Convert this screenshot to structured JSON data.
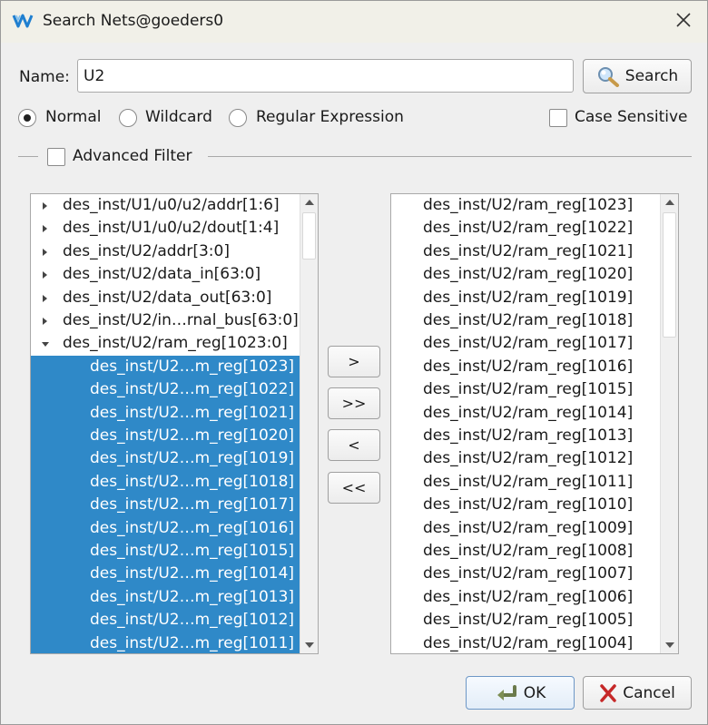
{
  "window": {
    "title": "Search Nets@goeders0"
  },
  "search": {
    "name_label": "Name:",
    "name_value": "U2",
    "search_label": "Search"
  },
  "mode": {
    "normal": "Normal",
    "wildcard": "Wildcard",
    "regex": "Regular Expression",
    "selected": "Normal"
  },
  "case_sensitive": {
    "label": "Case Sensitive",
    "checked": false
  },
  "advanced_filter": {
    "label": "Advanced Filter",
    "checked": false
  },
  "left_tree": {
    "groups": [
      {
        "label": "des_inst/U1/u0/u2/addr[1:6]",
        "expanded": false
      },
      {
        "label": "des_inst/U1/u0/u2/dout[1:4]",
        "expanded": false
      },
      {
        "label": "des_inst/U2/addr[3:0]",
        "expanded": false
      },
      {
        "label": "des_inst/U2/data_in[63:0]",
        "expanded": false
      },
      {
        "label": "des_inst/U2/data_out[63:0]",
        "expanded": false
      },
      {
        "label": "des_inst/U2/in…rnal_bus[63:0]",
        "expanded": false
      },
      {
        "label": "des_inst/U2/ram_reg[1023:0]",
        "expanded": true
      }
    ],
    "children": [
      "des_inst/U2…m_reg[1023]",
      "des_inst/U2…m_reg[1022]",
      "des_inst/U2…m_reg[1021]",
      "des_inst/U2…m_reg[1020]",
      "des_inst/U2…m_reg[1019]",
      "des_inst/U2…m_reg[1018]",
      "des_inst/U2…m_reg[1017]",
      "des_inst/U2…m_reg[1016]",
      "des_inst/U2…m_reg[1015]",
      "des_inst/U2…m_reg[1014]",
      "des_inst/U2…m_reg[1013]",
      "des_inst/U2…m_reg[1012]",
      "des_inst/U2…m_reg[1011]"
    ]
  },
  "transfer_buttons": {
    "add": ">",
    "add_all": ">>",
    "remove": "<",
    "remove_all": "<<"
  },
  "right_list": [
    "des_inst/U2/ram_reg[1023]",
    "des_inst/U2/ram_reg[1022]",
    "des_inst/U2/ram_reg[1021]",
    "des_inst/U2/ram_reg[1020]",
    "des_inst/U2/ram_reg[1019]",
    "des_inst/U2/ram_reg[1018]",
    "des_inst/U2/ram_reg[1017]",
    "des_inst/U2/ram_reg[1016]",
    "des_inst/U2/ram_reg[1015]",
    "des_inst/U2/ram_reg[1014]",
    "des_inst/U2/ram_reg[1013]",
    "des_inst/U2/ram_reg[1012]",
    "des_inst/U2/ram_reg[1011]",
    "des_inst/U2/ram_reg[1010]",
    "des_inst/U2/ram_reg[1009]",
    "des_inst/U2/ram_reg[1008]",
    "des_inst/U2/ram_reg[1007]",
    "des_inst/U2/ram_reg[1006]",
    "des_inst/U2/ram_reg[1005]",
    "des_inst/U2/ram_reg[1004]"
  ],
  "footer": {
    "ok": "OK",
    "cancel": "Cancel"
  },
  "colors": {
    "selection": "#2f89c8",
    "logo": "#1f7fd0"
  }
}
